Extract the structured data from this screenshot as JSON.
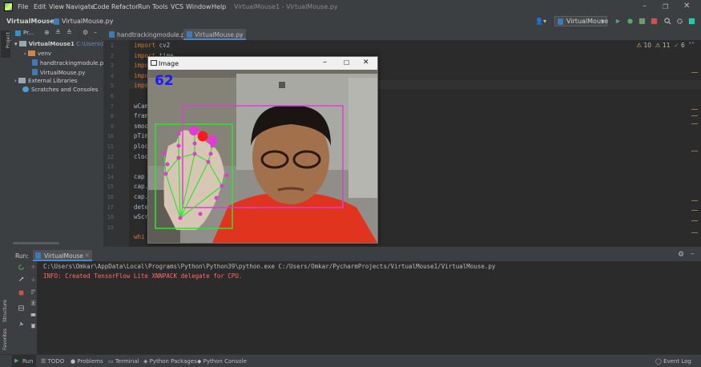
{
  "menu": [
    "File",
    "Edit",
    "View",
    "Navigate",
    "Code",
    "Refactor",
    "Run",
    "Tools",
    "VCS",
    "Window",
    "Help"
  ],
  "window_title": "VirtualMouse1 - VirtualMouse.py",
  "breadcrumbs": [
    "VirtualMouse1",
    "VirtualMouse.py"
  ],
  "run_config": "VirtualMouse",
  "project": {
    "toolbar_label": "Pr...",
    "root_name": "VirtualMouse1",
    "root_path": "C:\\Users\\Omka",
    "items": [
      "venv",
      "handtrackingmodule.py",
      "VirtualMouse.py",
      "External Libraries",
      "Scratches and Consoles"
    ]
  },
  "tabs": [
    "handtrackingmodule.py",
    "VirtualMouse.py"
  ],
  "inspections": {
    "warnings": "10",
    "weak_warnings": "11",
    "typos": "6"
  },
  "line_numbers": [
    "1",
    "2",
    "3",
    "4",
    "5",
    "6",
    "7",
    "8",
    "9",
    "10",
    "11",
    "12",
    "13",
    "14",
    "15",
    "16",
    "17",
    "18",
    "19"
  ],
  "code_lines": [
    {
      "kw": "import",
      "rest": " cv2"
    },
    {
      "kw": "import",
      "rest": " time"
    },
    {
      "kw": "impo",
      "rest": ""
    },
    {
      "kw": "impo",
      "rest": ""
    },
    {
      "kw": "impo",
      "rest": ""
    },
    {
      "kw": "",
      "rest": ""
    },
    {
      "kw": "",
      "rest": "wCam"
    },
    {
      "kw": "",
      "rest": "fram"
    },
    {
      "kw": "",
      "rest": "smoo"
    },
    {
      "kw": "",
      "rest": "pTim"
    },
    {
      "kw": "",
      "rest": "ploc"
    },
    {
      "kw": "",
      "rest": "cloc"
    },
    {
      "kw": "",
      "rest": ""
    },
    {
      "kw": "",
      "rest": "cap"
    },
    {
      "kw": "",
      "rest": "cap."
    },
    {
      "kw": "",
      "rest": "cap."
    },
    {
      "kw": "",
      "rest": "dete"
    },
    {
      "kw": "",
      "rest": "wScr"
    },
    {
      "kw": "",
      "rest": ""
    },
    {
      "kw": "whi",
      "rest": ""
    }
  ],
  "image_window": {
    "title": "Image",
    "fps": "62"
  },
  "run_panel": {
    "label": "Run:",
    "tab": "VirtualMouse",
    "console": [
      "C:\\Users\\Omkar\\AppData\\Local\\Programs\\Python\\Python39\\python.exe C:/Users/Omkar/PycharmProjects/VirtualMouse1/VirtualMouse.py",
      "INFO: Created TensorFlow Lite XNNPACK delegate for CPU."
    ]
  },
  "side_tabs": {
    "project": "Project",
    "structure": "Structure",
    "favorites": "Favorites"
  },
  "status": {
    "run": "Run",
    "todo": "TODO",
    "problems": "Problems",
    "terminal": "Terminal",
    "packages": "Python Packages",
    "console": "Python Console",
    "event_log": "Event Log"
  },
  "colors": {
    "accent": "#3592c4",
    "error_text": "#ff6b68",
    "hand_box": "#00ff00",
    "face_box": "#ff00ff",
    "fps": "#1a1aff"
  }
}
